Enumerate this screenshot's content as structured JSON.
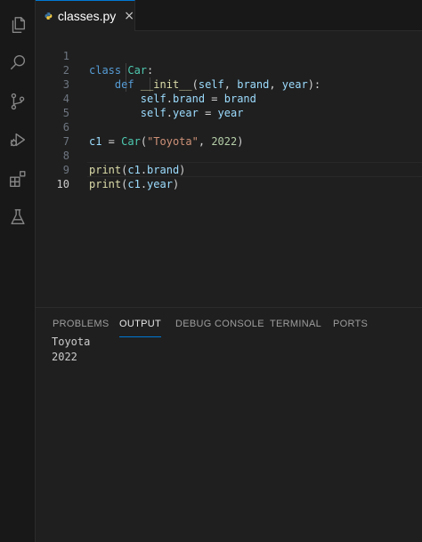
{
  "activity_bar": {
    "icons": [
      "files-icon",
      "search-icon",
      "source-control-icon",
      "run-debug-icon",
      "extensions-icon",
      "testing-icon"
    ]
  },
  "tab": {
    "label": "classes.py",
    "close": "×",
    "icon": "python-icon"
  },
  "editor": {
    "line_numbers": [
      "1",
      "2",
      "3",
      "4",
      "5",
      "6",
      "7",
      "8",
      "9",
      "10"
    ],
    "active_line": "10"
  },
  "code": {
    "l1": {
      "kw": "class",
      "cls": "Car",
      "tail": ":"
    },
    "l2": {
      "kw": "def",
      "fn": "__init__",
      "open": "(",
      "p1": "self",
      "c1": ", ",
      "p2": "brand",
      "c2": ", ",
      "p3": "year",
      "close": "):"
    },
    "l3": {
      "obj": "self",
      "dot": ".",
      "attr": "brand",
      "eq": " = ",
      "val": "brand"
    },
    "l4": {
      "obj": "self",
      "dot": ".",
      "attr": "year",
      "eq": " = ",
      "val": "year"
    },
    "l6": {
      "var": "c1",
      "eq": " = ",
      "cls": "Car",
      "open": "(",
      "str": "\"Toyota\"",
      "comma": ", ",
      "num": "2022",
      "close": ")"
    },
    "l8": {
      "fn": "print",
      "open": "(",
      "obj": "c1",
      "dot": ".",
      "attr": "brand",
      "close": ")"
    },
    "l9": {
      "fn": "print",
      "open": "(",
      "obj": "c1",
      "dot": ".",
      "attr": "year",
      "close": ")"
    }
  },
  "panel": {
    "tabs": [
      "PROBLEMS",
      "OUTPUT",
      "DEBUG CONSOLE",
      "TERMINAL",
      "PORTS"
    ],
    "active_tab": "OUTPUT",
    "output_lines": [
      "Toyota",
      "2022"
    ]
  },
  "colors": {
    "accent": "#0078d4",
    "keyword": "#569cd6",
    "class": "#4ec9b0",
    "function": "#dcdcaa",
    "variable": "#9cdcfe",
    "string": "#ce9178",
    "number": "#b5cea8"
  }
}
